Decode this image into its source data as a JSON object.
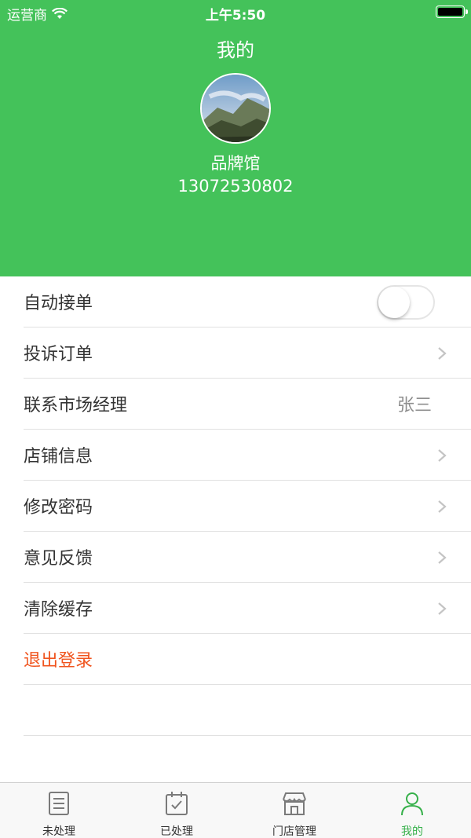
{
  "status_bar": {
    "carrier": "运营商",
    "time": "上午5:50"
  },
  "header": {
    "title": "我的",
    "name": "品牌馆",
    "phone": "13072530802"
  },
  "settings": {
    "auto_accept_label": "自动接单",
    "auto_accept_on": false,
    "complaint_orders_label": "投诉订单",
    "contact_manager_label": "联系市场经理",
    "contact_manager_value": "张三",
    "shop_info_label": "店铺信息",
    "change_password_label": "修改密码",
    "feedback_label": "意见反馈",
    "clear_cache_label": "清除缓存",
    "logout_label": "退出登录"
  },
  "tabbar": {
    "tabs": [
      {
        "label": "未处理",
        "icon": "document-list-icon"
      },
      {
        "label": "已处理",
        "icon": "calendar-check-icon"
      },
      {
        "label": "门店管理",
        "icon": "storefront-icon"
      },
      {
        "label": "我的",
        "icon": "person-icon",
        "active": true
      }
    ]
  },
  "colors": {
    "header_green": "#44c25a",
    "active_tab": "#36b04a",
    "logout_red": "#f0541e"
  }
}
